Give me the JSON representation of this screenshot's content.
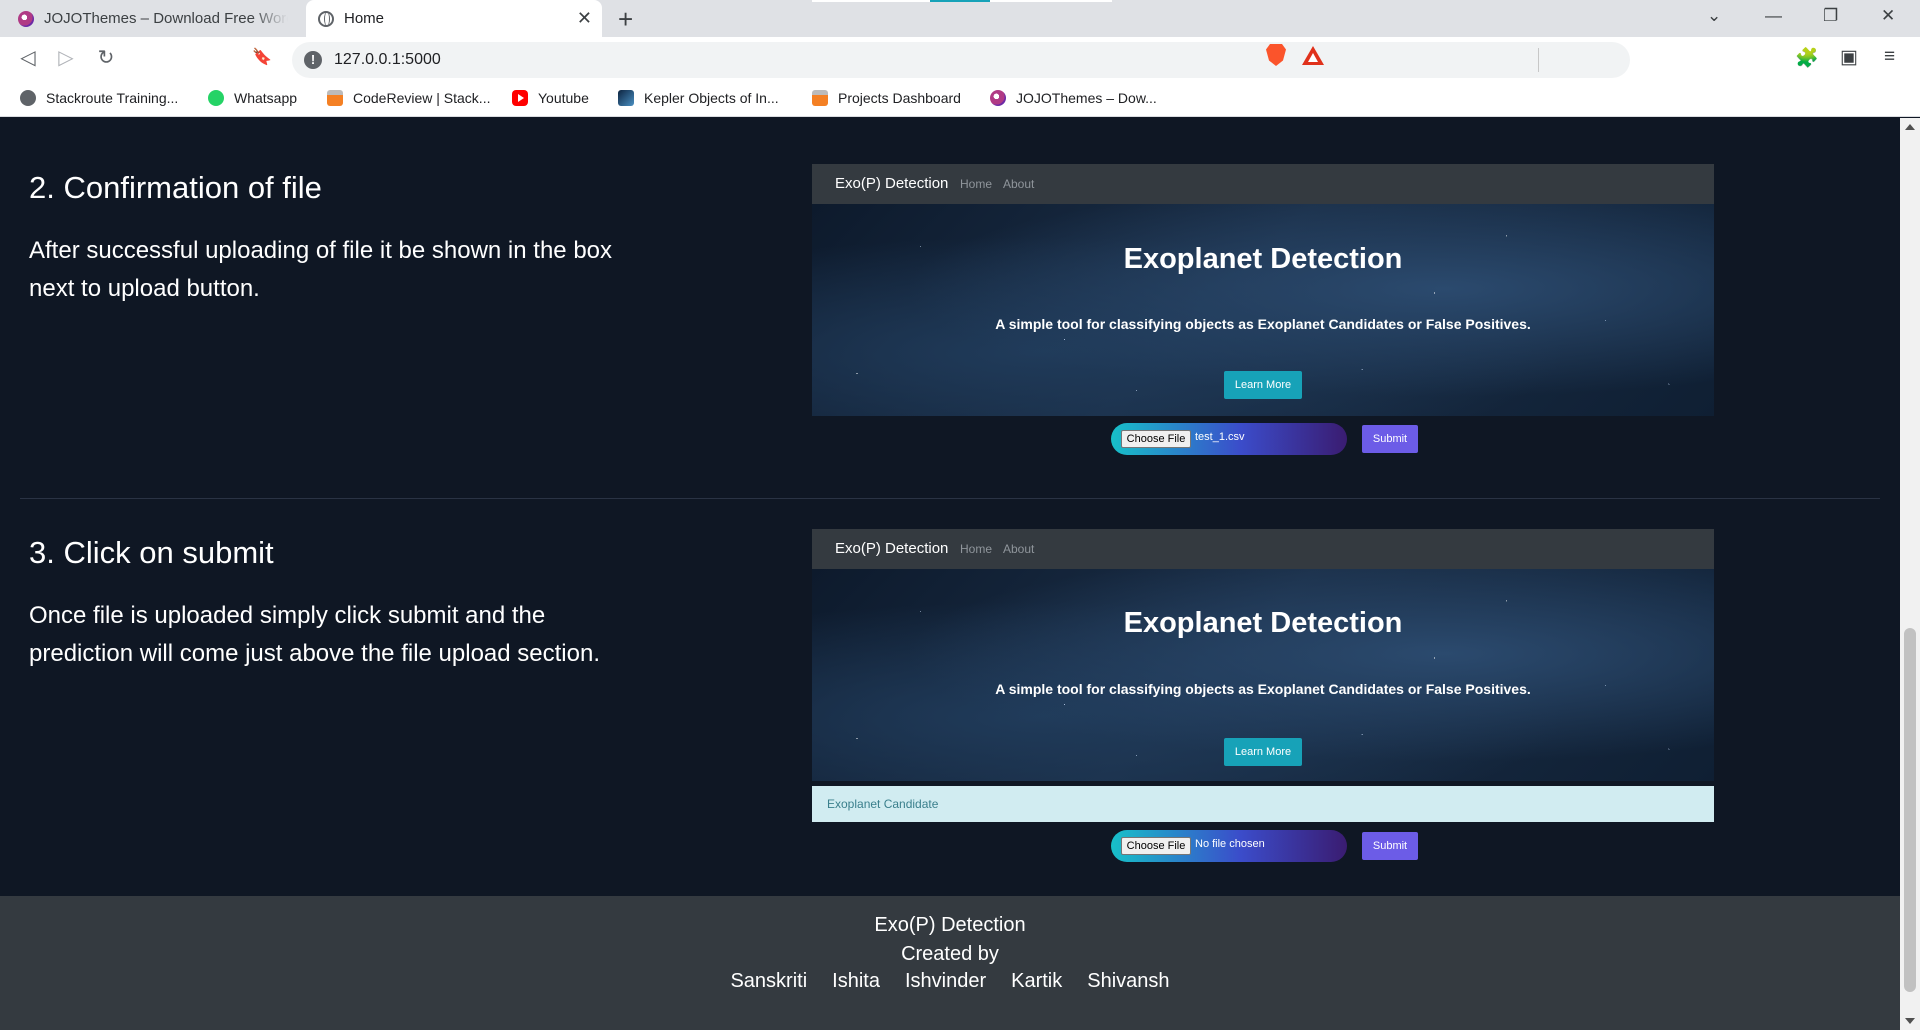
{
  "browser": {
    "tabs": [
      {
        "title": "JOJOThemes – Download Free WordPress"
      },
      {
        "title": "Home",
        "close": "✕"
      }
    ],
    "new_tab": "+",
    "window_controls": {
      "dropdown": "⌄",
      "minimize": "—",
      "restore": "❐",
      "close": "✕"
    },
    "nav": {
      "back": "◁",
      "forward": "▷",
      "reload": "↻",
      "bookmark": "🔖"
    },
    "address": {
      "info": "!",
      "url": "127.0.0.1:5000"
    },
    "toolbar_right": {
      "extensions": "🧩",
      "wallet": "▣",
      "menu": "≡"
    },
    "bookmarks": [
      {
        "label": "Stackroute Training...",
        "icon": "stackroute-icon"
      },
      {
        "label": "Whatsapp",
        "icon": "whatsapp-icon"
      },
      {
        "label": "CodeReview | Stack...",
        "icon": "stackoverflow-icon"
      },
      {
        "label": "Youtube",
        "icon": "youtube-icon"
      },
      {
        "label": "Kepler Objects of In...",
        "icon": "kepler-icon"
      },
      {
        "label": "Projects Dashboard",
        "icon": "stackoverflow-icon"
      },
      {
        "label": "JOJOThemes – Dow...",
        "icon": "jojothemes-icon"
      }
    ]
  },
  "steps": [
    {
      "heading": "2. Confirmation of file",
      "body": "After successful uploading of file it be shown in the box next to upload button.",
      "screenshot": {
        "brand": "Exo(P) Detection",
        "nav": [
          "Home",
          "About"
        ],
        "hero_title": "Exoplanet Detection",
        "hero_subtitle": "A simple tool for classifying objects as Exoplanet Candidates or False Positives.",
        "learn_more": "Learn More",
        "choose_file": "Choose File",
        "file_name": "test_1.csv",
        "submit": "Submit"
      }
    },
    {
      "heading": "3. Click on submit",
      "body": "Once file is uploaded simply click submit and the prediction will come just above the file upload section.",
      "screenshot": {
        "brand": "Exo(P) Detection",
        "nav": [
          "Home",
          "About"
        ],
        "hero_title": "Exoplanet Detection",
        "hero_subtitle": "A simple tool for classifying objects as Exoplanet Candidates or False Positives.",
        "learn_more": "Learn More",
        "result": "Exoplanet Candidate",
        "choose_file": "Choose File",
        "file_name": "No file chosen",
        "submit": "Submit"
      }
    }
  ],
  "footer": {
    "title": "Exo(P) Detection",
    "created_by": "Created by",
    "names": [
      "Sanskriti",
      "Ishita",
      "Ishvinder",
      "Kartik",
      "Shivansh"
    ]
  },
  "colors": {
    "page_bg": "#0f1724",
    "footer_bg": "#343a40",
    "accent_teal": "#17a2b8",
    "submit_purple": "#6c5ce7",
    "alert_bg": "#d1ecf1"
  }
}
